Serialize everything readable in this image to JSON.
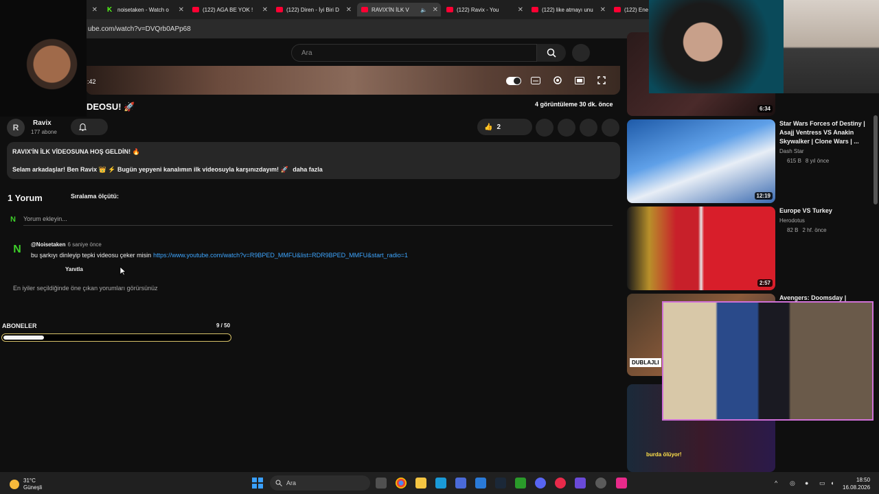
{
  "browser": {
    "tabs": [
      {
        "label": "",
        "active": false
      },
      {
        "label": "noisetaken - Watch o",
        "active": false
      },
      {
        "label": "(122) AGA BE YOK !",
        "active": false
      },
      {
        "label": "(122) Diren - İyi Biri D",
        "active": false
      },
      {
        "label": "RAVIX'İN İLK V",
        "active": true
      },
      {
        "label": "(122) Ravix - You",
        "active": false
      },
      {
        "label": "(122) like atmayı unu",
        "active": false
      },
      {
        "label": "(122) Ene",
        "active": false
      }
    ],
    "url": "ube.com/watch?v=DVQrb0APp68"
  },
  "youtube": {
    "search_placeholder": "Ara",
    "player_time": ":42",
    "video_title": "DEOSU! 🚀",
    "video_stats": "4 görüntüleme  30 dk. önce",
    "channel": {
      "name": "Ravix",
      "subs": "177 abone",
      "avatar_text": "R"
    },
    "likes": "2",
    "description": {
      "line1": "RAVIX'İN İLK VİDEOSUNA HOŞ GELDİN! 🔥",
      "line2": "Selam arkadaşlar! Ben Ravix 👑 ⚡ Bugün yepyeni kanalımın ilk videosuyla karşınızdayım! 🚀",
      "more": "daha fazla"
    },
    "comments": {
      "count": "1 Yorum",
      "sort_label": "Sıralama ölçütü:",
      "add_placeholder": "Yorum ekleyin...",
      "avatar_letter": "N",
      "items": [
        {
          "author": "@Noisetaken",
          "time": "6 saniye önce",
          "text": "bu şarkıyı dinleyip tepki videosu çeker misin",
          "link": "https://www.youtube.com/watch?v=R9BPED_MMFU&list=RDR9BPED_MMFU&start_radio=1",
          "reply": "Yanıtla"
        }
      ],
      "note": "En iyiler seçildiğinde öne çıkan yorumları görürsünüz"
    }
  },
  "overlay": {
    "sub_label": "ABONELER",
    "sub_count": "9 / 50",
    "sub_progress": 0.18
  },
  "related": [
    {
      "duration": "6:34",
      "title": "",
      "channel": "",
      "views": "",
      "age": ""
    },
    {
      "duration": "12:19",
      "title": "Star Wars Forces of Destiny | Asajj Ventress VS Anakin Skywalker | Clone Wars | ...",
      "channel": "Dash Star",
      "views": "615 B",
      "age": "8 yıl önce"
    },
    {
      "duration": "2:57",
      "title": "Europe VS Turkey",
      "channel": "Herodotus",
      "views": "82 B",
      "age": "2 hf. önce"
    },
    {
      "duration": "",
      "title": "Avengers: Doomsday |",
      "channel": "",
      "views": "",
      "age": ""
    }
  ],
  "thumb_texts": {
    "dublaj": "DUBLAJLI",
    "burda": "burda ölüyor!"
  },
  "taskbar": {
    "temp": "31°C",
    "weather": "Güneşli",
    "search": "Ara",
    "time": "18:50",
    "date": "16.08.2026"
  },
  "colors": {
    "accent": "#ff0033",
    "link": "#3ea6ff",
    "kick": "#53fc18",
    "bar_border": "#d9c36a"
  }
}
